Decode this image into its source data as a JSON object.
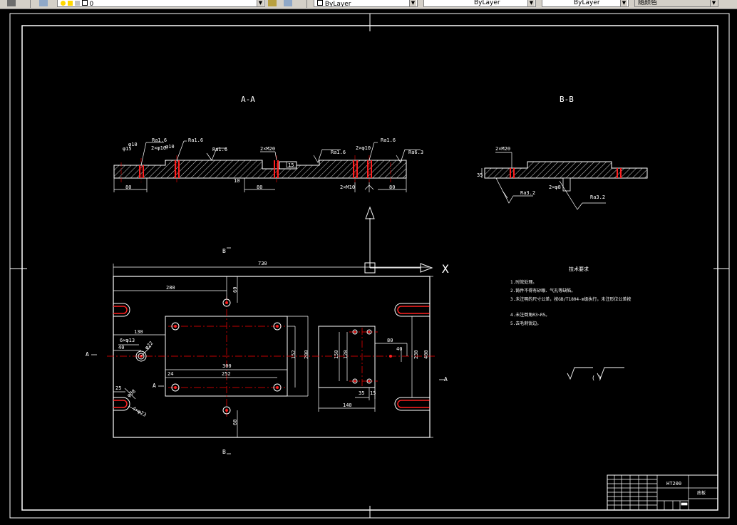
{
  "toolbar": {
    "layer_current": "0",
    "color_combo": "ByLayer",
    "linetype_combo": "ByLayer",
    "lineweight_combo": "ByLayer",
    "plotstyle_combo": "随颜色"
  },
  "drawing": {
    "section_aa": "A-A",
    "section_bb": "B-B",
    "aa_labels": {
      "phi15": "φ15",
      "phi10": "φ10",
      "ra16_a": "Ra1.6",
      "ra16_b": "Ra1.6",
      "ra16_c": "Ra1.6",
      "ra16_d": "Ra1.6",
      "ra16_e": "Ra1.6",
      "ra63": "Ra6.3",
      "m20_a": "2×M20",
      "m10_a": "2×φ10",
      "m10_b": "2×φ10",
      "m10_c": "2×M10",
      "box15": "15",
      "d80_a": "80",
      "d80_b": "80",
      "d80_c": "80",
      "d10": "10"
    },
    "bb_labels": {
      "m20": "2×M20",
      "d35": "35",
      "phi8": "2×φ8",
      "ra32_a": "Ra3.2",
      "ra32_b": "Ra3.2"
    },
    "plan_labels": {
      "d730": "730",
      "d280": "280",
      "d60_top": "60",
      "d130": "130",
      "phi13": "6×φ13",
      "d40_l": "40",
      "phi22": "φ22",
      "d300": "300",
      "d252": "252",
      "d24": "24",
      "d152": "152",
      "d200": "200",
      "d150": "150",
      "d120": "120",
      "d80_r": "80",
      "d40_r": "40",
      "d230": "230",
      "d400": "400",
      "d35": "35",
      "d15": "15",
      "d140": "140",
      "d25": "25",
      "phi38": "φ38",
      "phi23": "4×φ23",
      "d60_bot": "60",
      "sec_a_left": "A",
      "sec_a_right": "A",
      "sec_b_top": "B",
      "sec_b_bot": "B",
      "sec_a_mid": "A",
      "axis_x": "X"
    },
    "notes": {
      "title": "技术要求",
      "n1": "1.时效处理。",
      "n2": "2.铸件不得有砂眼、气孔等缺陷。",
      "n3": "3.未注明的尺寸公差，按GB/T1804-m级执行，未注形位公差按",
      "n4": "4.未注倒角R3~R5。",
      "n5": "5.去毛刺锐边。"
    },
    "roughness_note": "(  )",
    "title_block": {
      "material": "HT200",
      "part_name": "底板"
    }
  },
  "colors": {
    "background": "#000000",
    "lines": "#ffffff",
    "centerlines": "#ff0000",
    "holes_red": "#ff2020",
    "toolbar": "#d4d0c8"
  }
}
